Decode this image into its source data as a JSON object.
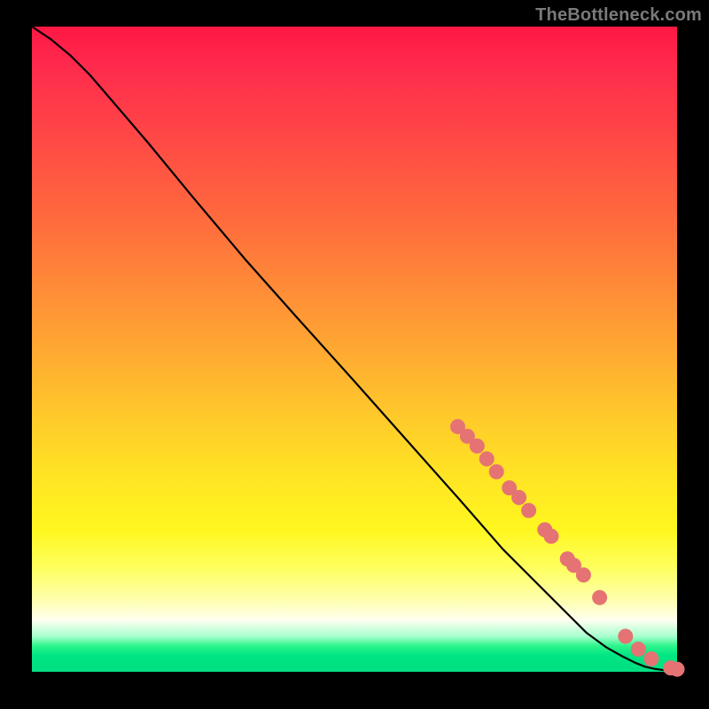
{
  "watermark": "TheBottleneck.com",
  "colors": {
    "dot": "#e57373",
    "curve": "#000000",
    "frame": "#000000"
  },
  "chart_data": {
    "type": "line",
    "title": "",
    "xlabel": "",
    "ylabel": "",
    "xlim": [
      0,
      100
    ],
    "ylim": [
      0,
      100
    ],
    "grid": false,
    "note": "No axis ticks or numeric labels are shown; values are normalized 0–100 estimated from pixel positions along the diagonal curve and scattered markers.",
    "series": [
      {
        "name": "curve",
        "kind": "line",
        "x": [
          0,
          3,
          6,
          9,
          12,
          18,
          25,
          33,
          41,
          50,
          58,
          66,
          73,
          78,
          83,
          86,
          89,
          91.5,
          93.5,
          95,
          96.5,
          98,
          99,
          100
        ],
        "y": [
          100,
          98,
          95.5,
          92.5,
          89,
          82,
          73.5,
          64,
          55,
          45,
          36,
          27,
          19,
          14,
          9,
          6,
          3.8,
          2.4,
          1.4,
          0.8,
          0.45,
          0.25,
          0.15,
          0.12
        ]
      },
      {
        "name": "markers",
        "kind": "scatter",
        "x": [
          66,
          67.5,
          69,
          70.5,
          72,
          74,
          75.5,
          77,
          79.5,
          80.5,
          83,
          84,
          85.5,
          88,
          92,
          94,
          96,
          99,
          100
        ],
        "y": [
          38,
          36.5,
          35,
          33,
          31,
          28.5,
          27,
          25,
          22,
          21,
          17.5,
          16.5,
          15,
          11.5,
          5.5,
          3.5,
          2,
          0.6,
          0.4
        ]
      }
    ]
  }
}
